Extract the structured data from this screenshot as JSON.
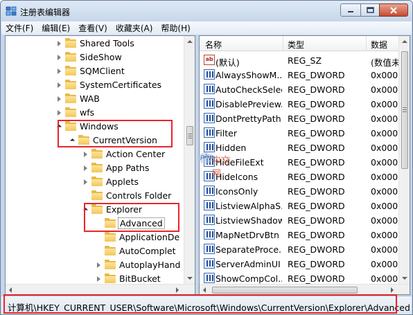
{
  "window": {
    "title": "注册表编辑器"
  },
  "menu": [
    "文件(F)",
    "编辑(E)",
    "查看(V)",
    "收藏夹(A)",
    "帮助(H)"
  ],
  "tree": [
    {
      "label": "Shared Tools",
      "expander": "right",
      "level": 0
    },
    {
      "label": "SideShow",
      "expander": "right",
      "level": 0
    },
    {
      "label": "SQMClient",
      "expander": "right",
      "level": 0
    },
    {
      "label": "SystemCertificates",
      "expander": "right",
      "level": 0
    },
    {
      "label": "WAB",
      "expander": "right",
      "level": 0
    },
    {
      "label": "wfs",
      "expander": "right",
      "level": 0
    },
    {
      "label": "Windows",
      "expander": "down",
      "level": 0
    },
    {
      "label": "CurrentVersion",
      "expander": "down",
      "level": 1
    },
    {
      "label": "Action Center",
      "expander": "right",
      "level": 2
    },
    {
      "label": "App Paths",
      "expander": "right",
      "level": 2
    },
    {
      "label": "Applets",
      "expander": "right",
      "level": 2
    },
    {
      "label": "Controls Folder",
      "expander": "none",
      "level": 2
    },
    {
      "label": "Explorer",
      "expander": "down",
      "level": 2
    },
    {
      "label": "Advanced",
      "expander": "none",
      "level": 3,
      "selected": true
    },
    {
      "label": "ApplicationDe",
      "expander": "none",
      "level": 3
    },
    {
      "label": "AutoComplet",
      "expander": "none",
      "level": 3
    },
    {
      "label": "AutoplayHand",
      "expander": "right",
      "level": 3
    },
    {
      "label": "BitBucket",
      "expander": "right",
      "level": 3
    }
  ],
  "list": {
    "columns": [
      "名称",
      "类型",
      "数据"
    ],
    "rows": [
      {
        "name": "(默认)",
        "type": "REG_SZ",
        "data": "(数值未",
        "icon": "string-value-icon"
      },
      {
        "name": "AlwaysShowM...",
        "type": "REG_DWORD",
        "data": "0x000",
        "icon": "dword-value-icon"
      },
      {
        "name": "AutoCheckSelect",
        "type": "REG_DWORD",
        "data": "0x000",
        "icon": "dword-value-icon"
      },
      {
        "name": "DisablePreview...",
        "type": "REG_DWORD",
        "data": "0x000",
        "icon": "dword-value-icon"
      },
      {
        "name": "DontPrettyPath",
        "type": "REG_DWORD",
        "data": "0x000",
        "icon": "dword-value-icon"
      },
      {
        "name": "Filter",
        "type": "REG_DWORD",
        "data": "0x000",
        "icon": "dword-value-icon"
      },
      {
        "name": "Hidden",
        "type": "REG_DWORD",
        "data": "0x000",
        "icon": "dword-value-icon"
      },
      {
        "name": "HideFileExt",
        "type": "REG_DWORD",
        "data": "0x000",
        "icon": "dword-value-icon"
      },
      {
        "name": "HideIcons",
        "type": "REG_DWORD",
        "data": "0x000",
        "icon": "dword-value-icon"
      },
      {
        "name": "IconsOnly",
        "type": "REG_DWORD",
        "data": "0x000",
        "icon": "dword-value-icon"
      },
      {
        "name": "ListviewAlphaS...",
        "type": "REG_DWORD",
        "data": "0x000",
        "icon": "dword-value-icon"
      },
      {
        "name": "ListviewShadow",
        "type": "REG_DWORD",
        "data": "0x000",
        "icon": "dword-value-icon"
      },
      {
        "name": "MapNetDrvBtn",
        "type": "REG_DWORD",
        "data": "0x000",
        "icon": "dword-value-icon"
      },
      {
        "name": "SeparateProce...",
        "type": "REG_DWORD",
        "data": "0x000",
        "icon": "dword-value-icon"
      },
      {
        "name": "ServerAdminUI",
        "type": "REG_DWORD",
        "data": "0x000",
        "icon": "dword-value-icon"
      },
      {
        "name": "ShowCompCol...",
        "type": "REG_DWORD",
        "data": "0x000",
        "icon": "dword-value-icon"
      }
    ]
  },
  "status": {
    "path": "计算机\\HKEY_CURRENT_USER\\Software\\Microsoft\\Windows\\CurrentVersion\\Explorer\\Advanced"
  },
  "watermark": {
    "letters": "php",
    "cn": "中文网"
  },
  "colors": {
    "highlight": "#e8242c",
    "folder": "#f3c65c",
    "frame": "#c3d6ec"
  }
}
